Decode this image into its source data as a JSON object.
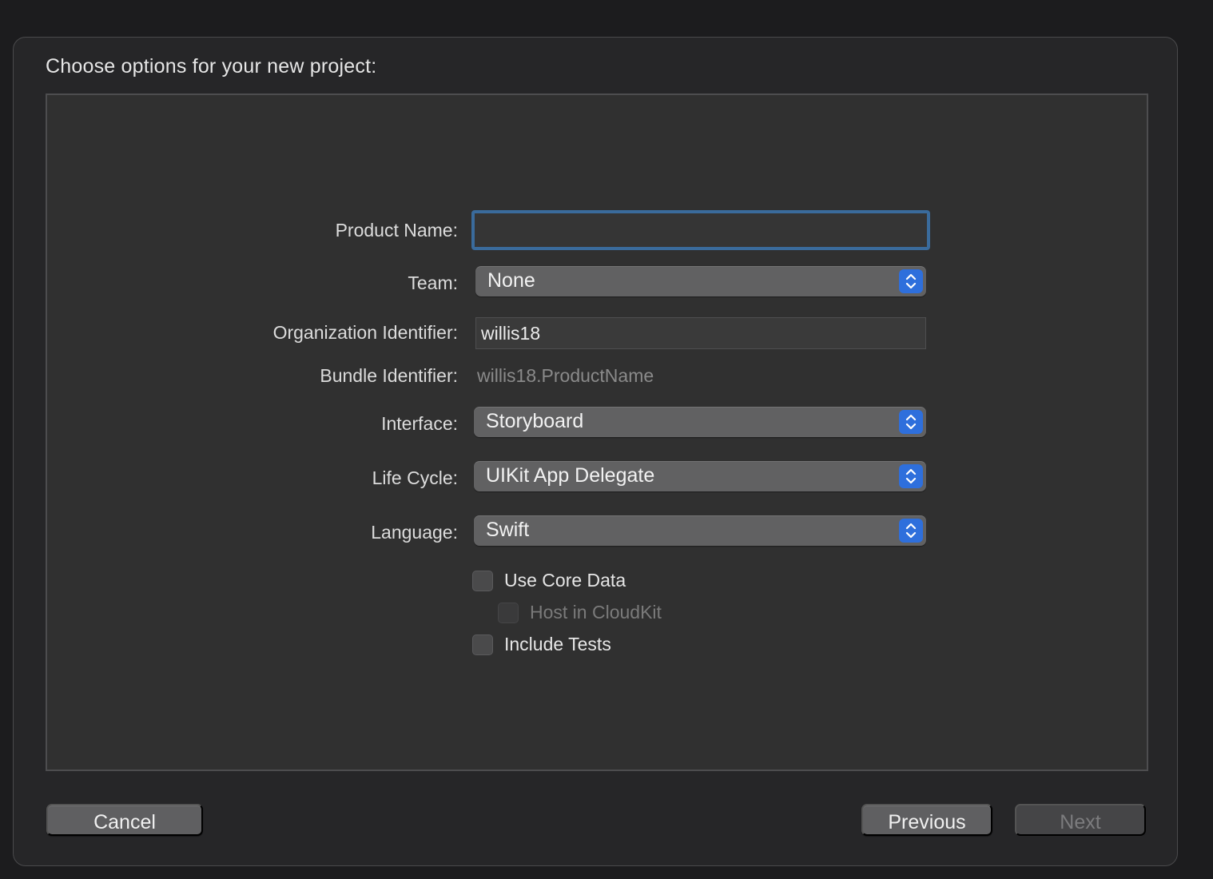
{
  "sheet": {
    "title": "Choose options for your new project:"
  },
  "form": {
    "product_name": {
      "label": "Product Name:",
      "value": ""
    },
    "team": {
      "label": "Team:",
      "selected": "None"
    },
    "organization_identifier": {
      "label": "Organization Identifier:",
      "value": "willis18"
    },
    "bundle_identifier": {
      "label": "Bundle Identifier:",
      "value": "willis18.ProductName"
    },
    "interface": {
      "label": "Interface:",
      "selected": "Storyboard"
    },
    "life_cycle": {
      "label": "Life Cycle:",
      "selected": "UIKit App Delegate"
    },
    "language": {
      "label": "Language:",
      "selected": "Swift"
    },
    "checkboxes": {
      "use_core_data": {
        "label": "Use Core Data",
        "checked": false
      },
      "host_in_cloudkit": {
        "label": "Host in CloudKit",
        "checked": false,
        "enabled": false
      },
      "include_tests": {
        "label": "Include Tests",
        "checked": false
      }
    }
  },
  "footer": {
    "cancel_label": "Cancel",
    "previous_label": "Previous",
    "next_label": "Next"
  },
  "icons": {
    "popup_stepper": "chevron-up-down-icon"
  },
  "colors": {
    "accent": "#2e6fdc",
    "focus_ring": "#3a6b9c"
  }
}
